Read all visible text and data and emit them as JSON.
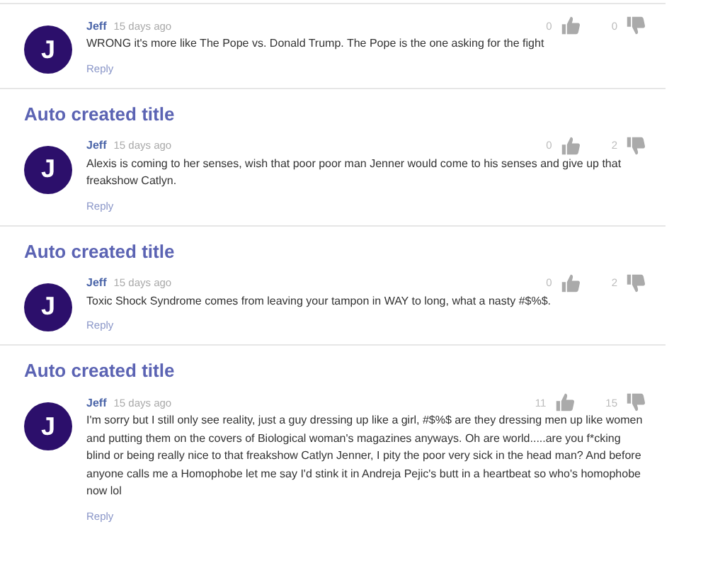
{
  "comments": [
    {
      "author": "Jeff",
      "initial": "J",
      "time": "15 days ago",
      "text": "WRONG it's more like The Pope vs. Donald Trump. The Pope is the one asking for the fight",
      "likes": "0",
      "dislikes": "0",
      "reply": "Reply"
    },
    {
      "title": "Auto created title",
      "author": "Jeff",
      "initial": "J",
      "time": "15 days ago",
      "text": "Alexis is coming to her senses, wish that poor poor man Jenner would come to his senses and give up that freakshow Catlyn.",
      "likes": "0",
      "dislikes": "2",
      "reply": "Reply"
    },
    {
      "title": "Auto created title",
      "author": "Jeff",
      "initial": "J",
      "time": "15 days ago",
      "text": "Toxic Shock Syndrome comes from leaving your tampon in WAY to long, what a nasty #$%$.",
      "likes": "0",
      "dislikes": "2",
      "reply": "Reply"
    },
    {
      "title": "Auto created title",
      "author": "Jeff",
      "initial": "J",
      "time": "15 days ago",
      "text": "I'm sorry but I still only see reality, just a guy dressing up like a girl, #$%$ are they dressing men up like women and putting them on the covers of Biological woman's magazines anyways. Oh are world.....are you f*cking blind or being really nice to that freakshow Catlyn Jenner, I pity the poor very sick in the head man? And before anyone calls me a Homophobe let me say I'd stink it in Andreja Pejic's butt in a heartbeat so who's homophobe now lol",
      "likes": "11",
      "dislikes": "15",
      "reply": "Reply"
    }
  ]
}
